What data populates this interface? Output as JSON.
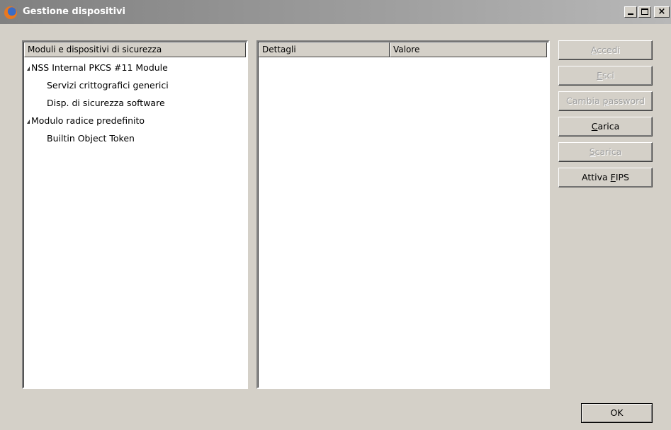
{
  "window": {
    "title": "Gestione dispositivi",
    "controls": {
      "minimize": "_",
      "maximize": "□",
      "close": "×"
    }
  },
  "modules_panel": {
    "header": "Moduli e dispositivi di sicurezza",
    "tree": [
      {
        "label": "NSS Internal PKCS #11 Module",
        "level": 0,
        "expanded": true
      },
      {
        "label": "Servizi crittografici generici",
        "level": 1
      },
      {
        "label": "Disp. di sicurezza software",
        "level": 1
      },
      {
        "label": "Modulo radice predefinito",
        "level": 0,
        "expanded": true
      },
      {
        "label": "Builtin Object Token",
        "level": 1
      }
    ]
  },
  "details_panel": {
    "col_details": "Dettagli",
    "col_value": "Valore"
  },
  "buttons": {
    "login": {
      "pre": "",
      "key": "A",
      "post": "ccedi",
      "enabled": false
    },
    "logout": {
      "pre": "",
      "key": "E",
      "post": "sci",
      "enabled": false
    },
    "change_password": {
      "pre": "Cambia ",
      "key": "p",
      "post": "assword",
      "enabled": false
    },
    "load": {
      "pre": "",
      "key": "C",
      "post": "arica",
      "enabled": true
    },
    "unload": {
      "pre": "",
      "key": "S",
      "post": "carica",
      "enabled": false
    },
    "fips": {
      "pre": "Attiva ",
      "key": "F",
      "post": "IPS",
      "enabled": true
    },
    "ok": {
      "label": "OK"
    }
  },
  "icons": {
    "app": "firefox-icon",
    "expander": "triangle-expanded-icon"
  }
}
